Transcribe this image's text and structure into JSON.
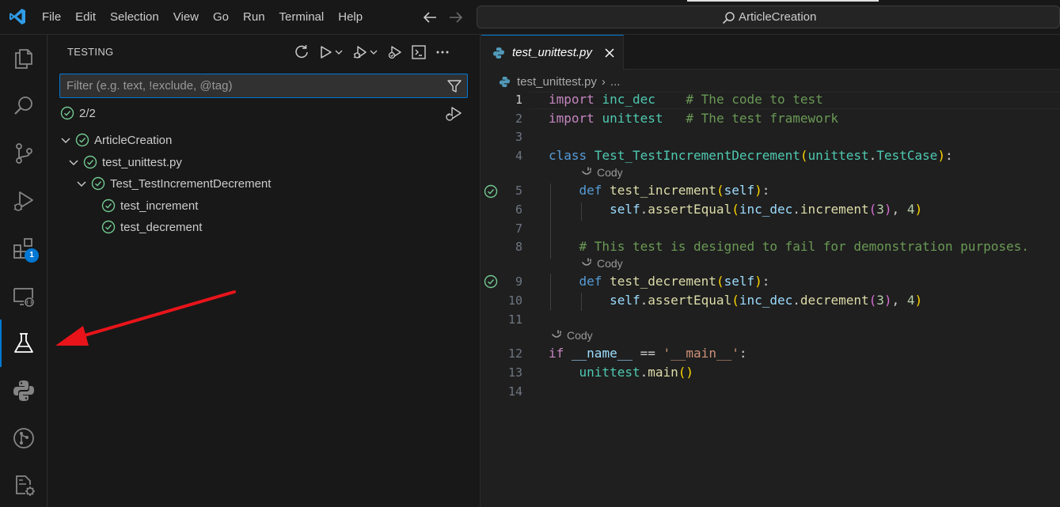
{
  "menu": [
    "File",
    "Edit",
    "Selection",
    "View",
    "Go",
    "Run",
    "Terminal",
    "Help"
  ],
  "search": {
    "text": "ArticleCreation"
  },
  "activity": {
    "badge": "1"
  },
  "sidebar": {
    "title": "TESTING",
    "filter_placeholder": "Filter (e.g. text, !exclude, @tag)",
    "summary": "2/2",
    "tree": [
      {
        "label": "ArticleCreation",
        "expanded": true,
        "status": "passed"
      },
      {
        "label": "test_unittest.py",
        "expanded": true,
        "status": "passed"
      },
      {
        "label": "Test_TestIncrementDecrement",
        "expanded": true,
        "status": "passed"
      },
      {
        "label": "test_increment",
        "status": "passed"
      },
      {
        "label": "test_decrement",
        "status": "passed"
      }
    ]
  },
  "editor": {
    "tab_label": "test_unittest.py",
    "breadcrumb": {
      "file": "test_unittest.py",
      "more": "..."
    },
    "codelens": "Cody",
    "line_numbers": [
      "1",
      "2",
      "3",
      "4",
      "5",
      "6",
      "7",
      "8",
      "9",
      "10",
      "11",
      "12",
      "13",
      "14"
    ],
    "code": {
      "l1": {
        "kw": "import",
        "mod": "inc_dec",
        "comment": "# The code to test"
      },
      "l2": {
        "kw": "import",
        "mod": "unittest",
        "comment": "# The test framework"
      },
      "l4": {
        "kw": "class",
        "name": "Test_TestIncrementDecrement",
        "base1": "unittest",
        "base2": "TestCase"
      },
      "l5": {
        "kw": "def",
        "name": "test_increment",
        "arg": "self"
      },
      "l6": {
        "self": "self",
        "fn": "assertEqual",
        "mod": "inc_dec",
        "call": "increment",
        "n1": "3",
        "n2": "4"
      },
      "l8": {
        "comment": "# This test is designed to fail for demonstration purposes."
      },
      "l9": {
        "kw": "def",
        "name": "test_decrement",
        "arg": "self"
      },
      "l10": {
        "self": "self",
        "fn": "assertEqual",
        "mod": "inc_dec",
        "call": "decrement",
        "n1": "3",
        "n2": "4"
      },
      "l12": {
        "kw": "if",
        "var": "__name__",
        "op": "==",
        "str": "'__main__'"
      },
      "l13": {
        "mod": "unittest",
        "fn": "main"
      }
    }
  },
  "colors": {
    "accent": "#0078d4",
    "pass": "#73c991",
    "annotation_arrow": "#e8141a"
  }
}
